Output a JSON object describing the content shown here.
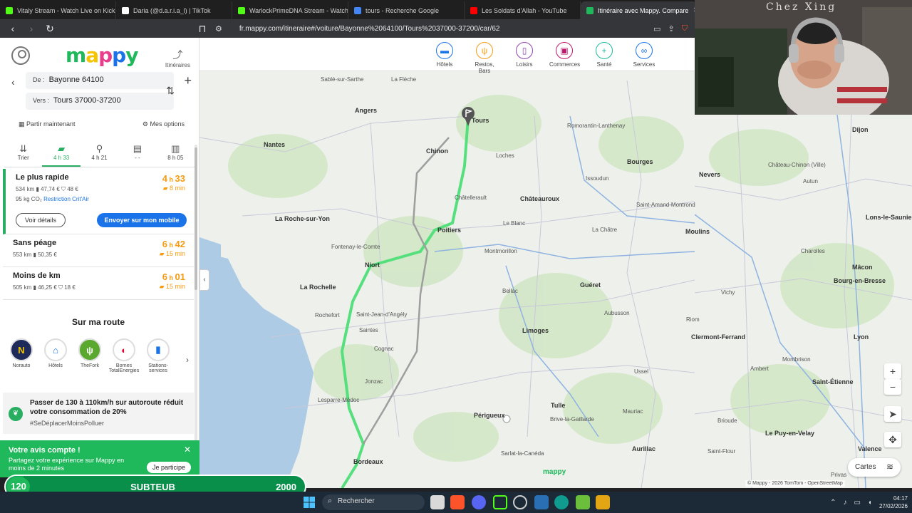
{
  "browser": {
    "tabs": [
      {
        "title": "Vitaly Stream - Watch Live on Kick",
        "icon": "kick-icon",
        "color": "#53fc18",
        "active": false
      },
      {
        "title": "Daria (@d.a.r.i.a_l) | TikTok",
        "icon": "tiktok-icon",
        "color": "#ffffff",
        "active": false
      },
      {
        "title": "WarlockPrimeDNA Stream - Watch Li",
        "icon": "kick-icon",
        "color": "#53fc18",
        "active": false
      },
      {
        "title": "tours - Recherche Google",
        "icon": "google-icon",
        "color": "#4285f4",
        "active": false
      },
      {
        "title": "Les Soldats d'Allah - YouTube",
        "icon": "youtube-icon",
        "color": "#ff0000",
        "active": false
      },
      {
        "title": "Itinéraire avec Mappy. Compare",
        "icon": "mappy-icon",
        "color": "#1fb85a",
        "active": true
      }
    ],
    "url": "fr.mappy.com/itineraire#/voiture/Bayonne%2064100/Tours%2037000-37200/car/62"
  },
  "sidebar": {
    "logo": "mappy",
    "itineraries_label": "Itinéraires",
    "from_label": "De :",
    "from_value": "Bayonne 64100",
    "to_label": "Vers :",
    "to_value": "Tours 37000-37200",
    "depart_label": "Partir maintenant",
    "options_label": "Mes options",
    "modes": [
      {
        "icon": "sort-icon",
        "label": "Trier",
        "active": false
      },
      {
        "icon": "car-icon",
        "label": "4 h 33",
        "active": true
      },
      {
        "icon": "motorbike-icon",
        "label": "4 h 21",
        "active": false
      },
      {
        "icon": "train-icon",
        "label": "- -",
        "active": false
      },
      {
        "icon": "bus-icon",
        "label": "8 h 05",
        "active": false
      }
    ],
    "routes": [
      {
        "name": "Le plus rapide",
        "time_h": "4",
        "time_m": "33",
        "delay": "8 min",
        "info": "534 km  ▮ 47,74 €  ⛉ 48 €",
        "co2": "95 kg CO₂",
        "co2_link": "Restriction Crit'Air",
        "details_btn": "Voir détails",
        "send_btn": "Envoyer sur mon mobile"
      },
      {
        "name": "Sans péage",
        "time_h": "6",
        "time_m": "42",
        "delay": "15 min",
        "info": "553 km  ▮ 50,35 €"
      },
      {
        "name": "Moins de km",
        "time_h": "6",
        "time_m": "01",
        "delay": "15 min",
        "info": "505 km  ▮ 46,25 €  ⛉ 18 €"
      }
    ],
    "on_route_title": "Sur ma route",
    "pois": [
      {
        "label": "Norauto",
        "glyph": "N",
        "color": "#1e2a5a",
        "text_color": "#f5c400"
      },
      {
        "label": "Hôtels",
        "glyph": "⌂",
        "color": "#ffffff",
        "text_color": "#1a73e8"
      },
      {
        "label": "TheFork",
        "glyph": "ψ",
        "color": "#5aa82d",
        "text_color": "#ffffff"
      },
      {
        "label": "Bornes TotalEnergies",
        "glyph": "◐",
        "color": "#ffffff",
        "text_color": "#e4002b"
      },
      {
        "label": "Stations-services",
        "glyph": "▮",
        "color": "#ffffff",
        "text_color": "#1a73e8"
      }
    ],
    "eco_title": "Passer de 130 à 110km/h sur autoroute réduit votre consommation de 20%",
    "eco_tag": "#SeDéplacerMoinsPolluer"
  },
  "feedback": {
    "title": "Votre avis compte !",
    "text": "Partagez votre expérience sur Mappy en moins de 2 minutes",
    "button": "Je participe"
  },
  "subgoal": {
    "current": "120",
    "label": "SUBTEUB",
    "goal": "2000",
    "progress_fraction": 0.06
  },
  "map": {
    "categories": [
      {
        "label": "Hôtels",
        "glyph": "▬",
        "color": "#1a73e8"
      },
      {
        "label": "Restos, Bars",
        "glyph": "ψ",
        "color": "#f39c12"
      },
      {
        "label": "Loisirs",
        "glyph": "▯",
        "color": "#8e44ad"
      },
      {
        "label": "Commerces",
        "glyph": "▣",
        "color": "#c0166b"
      },
      {
        "label": "Santé",
        "glyph": "+",
        "color": "#1abc9c"
      },
      {
        "label": "Services",
        "glyph": "∞",
        "color": "#1a73e8"
      }
    ],
    "cities": [
      "Tours",
      "Angers",
      "Nantes",
      "Chinon",
      "Bourges",
      "Dijon",
      "Nevers",
      "Châteauroux",
      "Poitiers",
      "Moulins",
      "Niort",
      "La Rochelle",
      "Guéret",
      "Limoges",
      "Clermont-Ferrand",
      "Périgueux",
      "Tulle",
      "Aurillac",
      "Bordeaux",
      "Mâcon",
      "Lyon",
      "Saint-Étienne",
      "Valence",
      "Le Puy-en-Velay",
      "La Roche-sur-Yon",
      "Bourg-en-Bresse",
      "Lons-le-Saunier"
    ],
    "towns": [
      "Sablé-sur-Sarthe",
      "La Flèche",
      "Loches",
      "Issoudun",
      "Le Blanc",
      "La Châtre",
      "Montmorillon",
      "Bellac",
      "Aubusson",
      "Vichy",
      "Riom",
      "Saintes",
      "Cognac",
      "Rochefort",
      "Saint-Jean-d'Angély",
      "Fontenay-le-Comte",
      "Châtellerault",
      "Autun",
      "Charolles",
      "Brive-la-Gaillarde",
      "Mauriac",
      "Brioude",
      "Saint-Flour",
      "Sarlat-la-Canéda",
      "Jonzac",
      "Lesparre-Médoc",
      "Ambert",
      "Montbrison",
      "Romorantin-Lanthenay",
      "Château-Chinon (Ville)",
      "Saint-Amand-Montrond",
      "Ussel",
      "Privas"
    ],
    "cartes_label": "Cartes",
    "copyright": "© Mappy - 2026 TomTom - OpenStreetMap",
    "watermark": "mappy",
    "route_color": "#55e07d",
    "alt_route_color": "#9e9e9e"
  },
  "webcam": {
    "sign": "Chez Xing"
  },
  "taskbar": {
    "search_placeholder": "Rechercher",
    "time": "04:17",
    "date": "27/02/2026"
  }
}
